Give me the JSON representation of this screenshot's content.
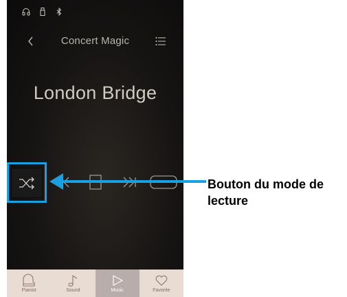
{
  "nav": {
    "title": "Concert Magic"
  },
  "song": {
    "title": "London Bridge"
  },
  "tabs": [
    {
      "label": "Pianist"
    },
    {
      "label": "Sound"
    },
    {
      "label": "Music"
    },
    {
      "label": "Favorite"
    }
  ],
  "callout": {
    "text": "Bouton du mode de lecture"
  },
  "colors": {
    "highlight": "#1a9fe0",
    "tabbar": "#e9dcd2",
    "tab_active": "#b8adaa"
  }
}
